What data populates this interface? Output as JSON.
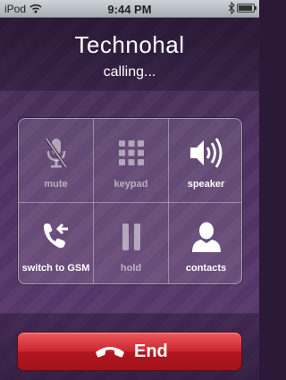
{
  "status_bar": {
    "carrier": "iPod",
    "time": "9:44 PM"
  },
  "call": {
    "contact_name": "Technohal",
    "status": "calling..."
  },
  "controls": {
    "mute": "mute",
    "keypad": "keypad",
    "speaker": "speaker",
    "switch": "switch to GSM",
    "hold": "hold",
    "contacts": "contacts"
  },
  "end_button": {
    "label": "End"
  },
  "colors": {
    "background": "#4e3160",
    "end_button": "#c9262e"
  },
  "icons": [
    "wifi-icon",
    "bluetooth-icon",
    "battery-icon",
    "mute-mic-icon",
    "keypad-icon",
    "speaker-icon",
    "switch-call-icon",
    "pause-icon",
    "contact-person-icon",
    "phone-hangup-icon"
  ]
}
